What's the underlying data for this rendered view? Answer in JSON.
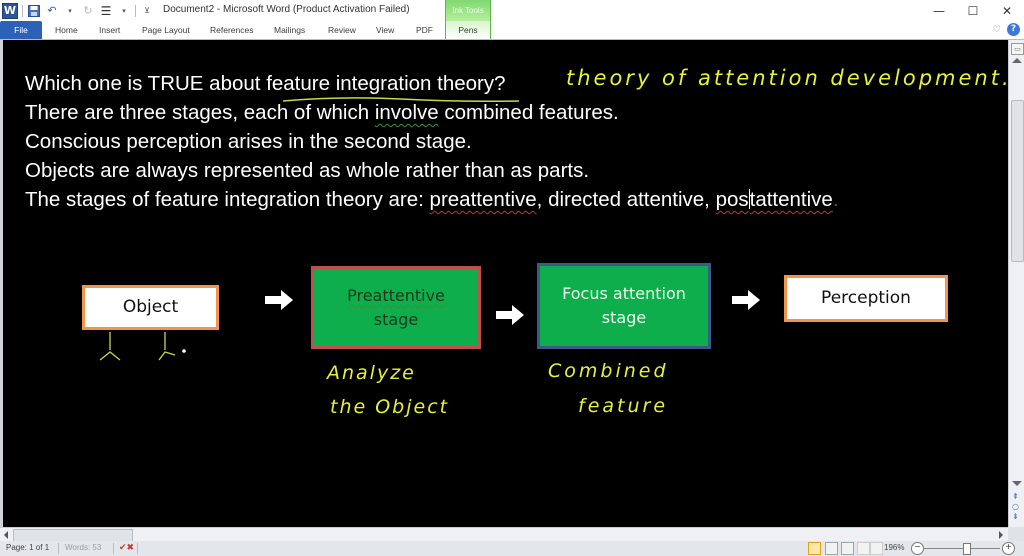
{
  "window": {
    "title": "Document2  -  Microsoft Word (Product Activation Failed)",
    "contextual_tab_group": "Ink Tools",
    "controls": {
      "minimize": "—",
      "maximize": "☐",
      "close": "✕"
    }
  },
  "quick_access": {
    "icons": [
      "word-logo-icon",
      "save-icon",
      "undo-icon",
      "redo-icon",
      "customize-icon"
    ],
    "word_logo_glyph": "W"
  },
  "ribbon": {
    "tabs": [
      {
        "label": "File",
        "active": true
      },
      {
        "label": "Home"
      },
      {
        "label": "Insert"
      },
      {
        "label": "Page Layout"
      },
      {
        "label": "References"
      },
      {
        "label": "Mailings"
      },
      {
        "label": "Review"
      },
      {
        "label": "View"
      },
      {
        "label": "PDF"
      },
      {
        "label": "Pens"
      }
    ],
    "help_glyph": "?",
    "heart_glyph": "♡"
  },
  "document": {
    "question": {
      "prefix": "Which one is TRUE about ",
      "highlight": "feature integration theory",
      "suffix": "?"
    },
    "options": [
      {
        "before": "There are three stages, each of which ",
        "marked": "involve",
        "after": " combined features."
      },
      {
        "text": "Conscious perception arises in the second stage."
      },
      {
        "text": "Objects are always represented as whole rather than as parts."
      },
      {
        "before": "The stages of feature integration theory are: ",
        "w1": "preattentive",
        "mid": ", directed attentive, ",
        "w2a": "pos",
        "w2b": "tattentive",
        "end": "."
      }
    ],
    "handwriting": {
      "top_note": "theory of attention development.",
      "note_under_preattentive_1": "Analyze",
      "note_under_preattentive_2": "the Object",
      "note_under_focus_1": "Combined",
      "note_under_focus_2": "feature"
    },
    "diagram": {
      "boxes": [
        {
          "label": "Object"
        },
        {
          "label_line1": "Preattentive",
          "label_line2": "stage"
        },
        {
          "label_line1": "Focus attention",
          "label_line2": "stage"
        },
        {
          "label": "Perception"
        }
      ],
      "colors": {
        "white_box_border": "#f0954a",
        "green_fill": "#0fae4d",
        "preattentive_border": "#c0504d",
        "focus_border": "#3a5a8a",
        "ink": "#e8f03a"
      }
    }
  },
  "status_bar": {
    "page": "Page: 1 of 1",
    "words": "Words: 53",
    "zoom": "196%",
    "zoom_minus": "−",
    "zoom_plus": "+",
    "zoom_fraction": 0.55
  },
  "scrollbar": {
    "page_up_glyph": "⇞",
    "select_browse_glyph": "○",
    "page_down_glyph": "⇟"
  }
}
